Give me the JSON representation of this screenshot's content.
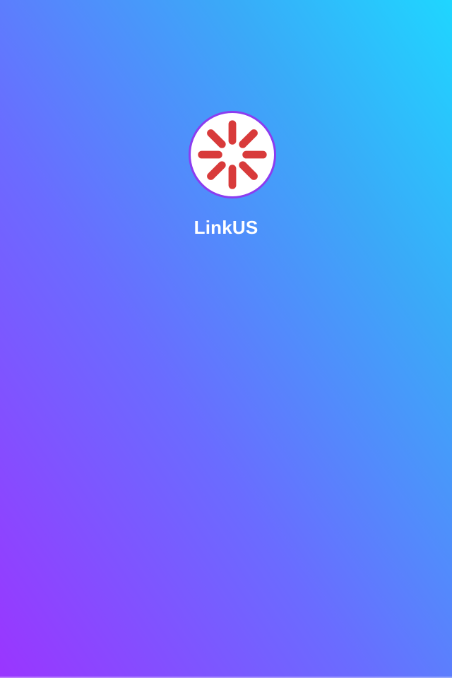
{
  "app": {
    "name": "LinkUS",
    "logo_icon": "spinner-burst-icon"
  },
  "colors": {
    "gradient_bottom_left": "#9a35ff",
    "gradient_top_right": "#1fd6ff",
    "logo_ring": "#8c3cf0",
    "logo_spokes": "#d83a3a",
    "text": "#ffffff"
  }
}
